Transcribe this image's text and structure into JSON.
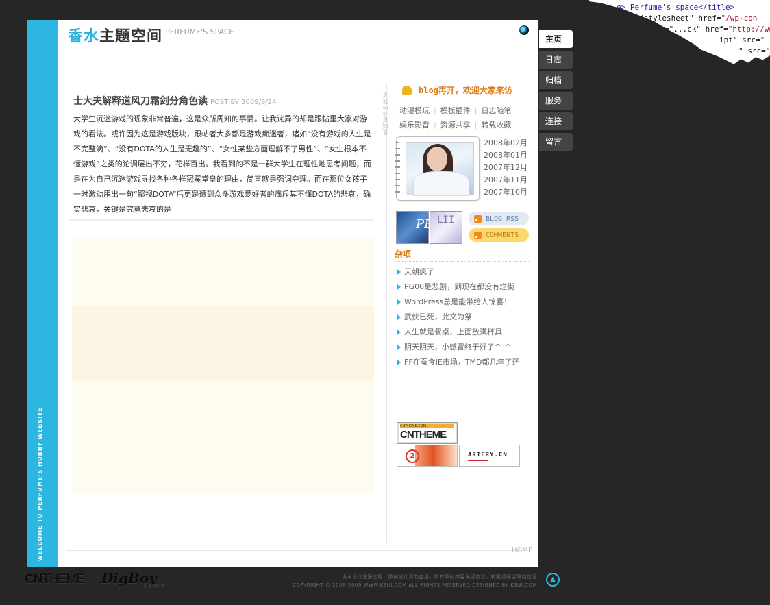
{
  "header": {
    "title_highlight": "香水",
    "title_rest": "主题空间",
    "title_en": "PERFUME'S SPACE"
  },
  "left_strip": {
    "vertical_text": "WELCOME TO PERFUME'S HOBBY WEBSITE"
  },
  "nav": {
    "items": [
      {
        "label": "主页",
        "active": true
      },
      {
        "label": "日志"
      },
      {
        "label": "归档"
      },
      {
        "label": "服务"
      },
      {
        "label": "连接"
      },
      {
        "label": "留言"
      }
    ]
  },
  "post": {
    "title": "士大夫解释道风刀霜剑分角色读",
    "meta": "POST BY 2009/8/24",
    "body": "大学生沉迷游戏的现象非常普遍，这是众所周知的事情。让我诧异的却是跟帖里大家对游戏的看法。或许因为这是游戏版块，跟帖者大多都是游戏痴迷者，诸如“没有游戏的人生是不完整滴”、“没有DOTA的人生是无趣的”、“女性某些方面理解不了男性”、“女生根本不懂游戏”之类的论调层出不穷，花样百出。我看到的不是一群大学生在理性地思考问题，而是在为自己沉迷游戏寻找各种各样冠冕堂皇的理由，简直就是强词夺理。而在那位女孩子一时激动甩出一句“鄙视DOTA”后更是遭到众多游戏爱好者的痛斥其不懂DOTA的悲哀，确实悲哀，关键是究竟悲哀的是"
  },
  "sidebar": {
    "tagline": "天涯何处觅知音",
    "welcome": "blog再开，欢迎大家来访",
    "categories": [
      [
        "动漫模玩",
        "模板插件",
        "日志随笔"
      ],
      [
        "娱乐影音",
        "资源共享",
        "转载收藏"
      ]
    ],
    "archives": [
      "2008年02月",
      "2008年01月",
      "2007年12月",
      "2007年11月",
      "2007年10月"
    ],
    "thumb1_text": "PE",
    "thumb2_text": "LII",
    "rss_blog": "BLOG RSS",
    "rss_comments": "COMMENTS",
    "misc_title": "杂项",
    "misc_items": [
      "天朝疯了",
      "PG00是悲剧，到现在都没有烂街",
      "WordPress总是能带给人惊喜！",
      "武侠已死，此文为祭",
      "人生就是餐桌，上面放满杯具",
      "阴天阴天，小感冒终于好了^_^",
      "FF在蚕食IE市场，TMD都几年了还"
    ],
    "badges": {
      "cntheme_small": "CNTHEME.COM",
      "cntheme": "CNTHEME",
      "two": "2",
      "artery": "ARTERY.CN"
    }
  },
  "footer": {
    "home_link": "HOME",
    "logo1_bold": "CN",
    "logo1_thin": "THEME",
    "logo2": "DigBoy",
    "logo2_small": "GROUP",
    "copyright_line1": "香水设计站第三版，原创设计请勿盗用，所有原创内容保留协议，转载请保留原始信息",
    "copyright_line2": "COPYRIGHT © 2008-2009 WWW.K3UI.COM ALL RIGHTS RESERVED DESIGNED BY K3UI.COM",
    "top_button": "▲"
  },
  "source_overlay": {
    "line1_a": "e> Perfume's space",
    "line1_b": "</title>",
    "line2_a": "l=\"stylesheet\" href=",
    "line2_b": "\"/wp-con",
    "line3_a": "=\"...ck\" href=",
    "line3_b": "\"http://ww",
    "line4_a": "ipt\" src=",
    "line4_b": "\"",
    "line5_a": "\" src=",
    "line5_b": "\""
  }
}
